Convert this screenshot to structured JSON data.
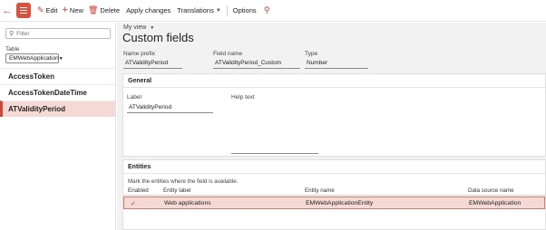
{
  "toolbar": {
    "edit": "Edit",
    "new": "New",
    "delete": "Delete",
    "apply_changes": "Apply changes",
    "translations": "Translations",
    "options": "Options"
  },
  "left": {
    "filter_placeholder": "Filter",
    "table_label": "Table",
    "table_value": "EMWebApplication",
    "items": [
      "AccessToken",
      "AccessTokenDateTime",
      "ATValidityPeriod"
    ],
    "selected_index": 2
  },
  "main": {
    "view_label": "My view",
    "title": "Custom fields",
    "name_prefix_label": "Name prefix",
    "name_prefix_value": "ATValidityPeriod",
    "field_name_label": "Field name",
    "field_name_value": "ATValidityPeriod_Custom",
    "type_label": "Type",
    "type_value": "Number"
  },
  "general": {
    "title": "General",
    "label_label": "Label",
    "label_value": "ATValidityPeriod",
    "help_text_label": "Help text",
    "help_text_value": ""
  },
  "entities": {
    "title": "Entities",
    "note": "Mark the entities where the field is available.",
    "columns": [
      "Enabled",
      "Entity label",
      "Entity name",
      "Data source name"
    ],
    "rows": [
      {
        "enabled": true,
        "label": "Web applications",
        "name": "EMWebApplicationEntity",
        "data_source": "EMWebApplication"
      }
    ]
  },
  "colors": {
    "accent": "#d9523d",
    "selection": "#f4d9d4"
  }
}
